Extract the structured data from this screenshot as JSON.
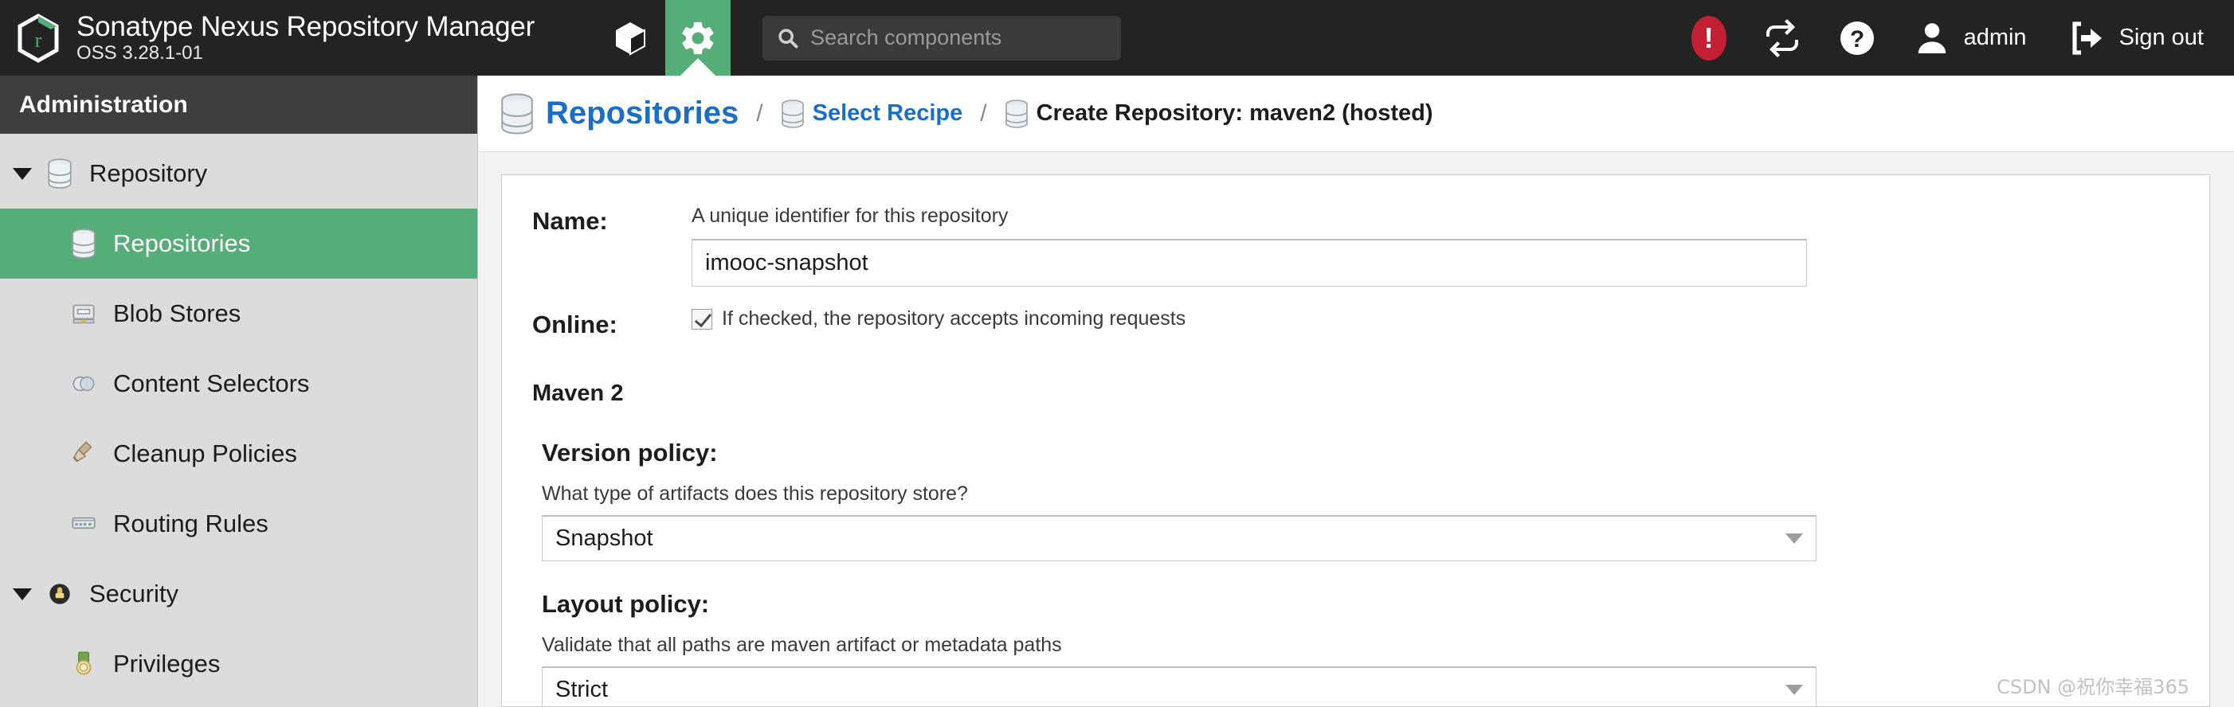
{
  "header": {
    "brand_title": "Sonatype Nexus Repository Manager",
    "brand_version": "OSS 3.28.1-01",
    "browse_icon": "cube-icon",
    "admin_icon": "gear-icon",
    "search": {
      "placeholder": "Search components",
      "value": "",
      "icon": "search-icon"
    },
    "alert_icon": "alert-exclamation-icon",
    "refresh_icon": "refresh-icon",
    "help_icon": "help-question-icon",
    "user_icon": "user-avatar-icon",
    "user_label": "admin",
    "signout_icon": "sign-out-icon",
    "signout_label": "Sign out",
    "background_color": "#232323",
    "accent_color": "#55ae77"
  },
  "sidebar": {
    "title": "Administration",
    "items": [
      {
        "label": "Repository",
        "icon": "database-icon",
        "level": "group",
        "expanded": true,
        "active": false
      },
      {
        "label": "Repositories",
        "icon": "database-icon",
        "level": "child",
        "expanded": false,
        "active": true
      },
      {
        "label": "Blob Stores",
        "icon": "blob-store-icon",
        "level": "child",
        "expanded": false,
        "active": false
      },
      {
        "label": "Content Selectors",
        "icon": "content-selector-icon",
        "level": "child",
        "expanded": false,
        "active": false
      },
      {
        "label": "Cleanup Policies",
        "icon": "broom-icon",
        "level": "child",
        "expanded": false,
        "active": false
      },
      {
        "label": "Routing Rules",
        "icon": "routing-rules-icon",
        "level": "child",
        "expanded": false,
        "active": false
      },
      {
        "label": "Security",
        "icon": "security-shield-icon",
        "level": "group",
        "expanded": true,
        "active": false
      },
      {
        "label": "Privileges",
        "icon": "privileges-icon",
        "level": "child",
        "expanded": false,
        "active": false
      }
    ]
  },
  "breadcrumb": {
    "root": "Repositories",
    "separator": "/",
    "link": "Select Recipe",
    "current": "Create Repository: maven2 (hosted)"
  },
  "form": {
    "name": {
      "label": "Name:",
      "hint": "A unique identifier for this repository",
      "value": "imooc-snapshot"
    },
    "online": {
      "label": "Online:",
      "checked": true,
      "hint": "If checked, the repository accepts incoming requests"
    },
    "maven_section_title": "Maven 2",
    "version_policy": {
      "label": "Version policy:",
      "hint": "What type of artifacts does this repository store?",
      "value": "Snapshot"
    },
    "layout_policy": {
      "label": "Layout policy:",
      "hint": "Validate that all paths are maven artifact or metadata paths",
      "value": "Strict"
    }
  },
  "watermark": "CSDN @祝你幸福365"
}
